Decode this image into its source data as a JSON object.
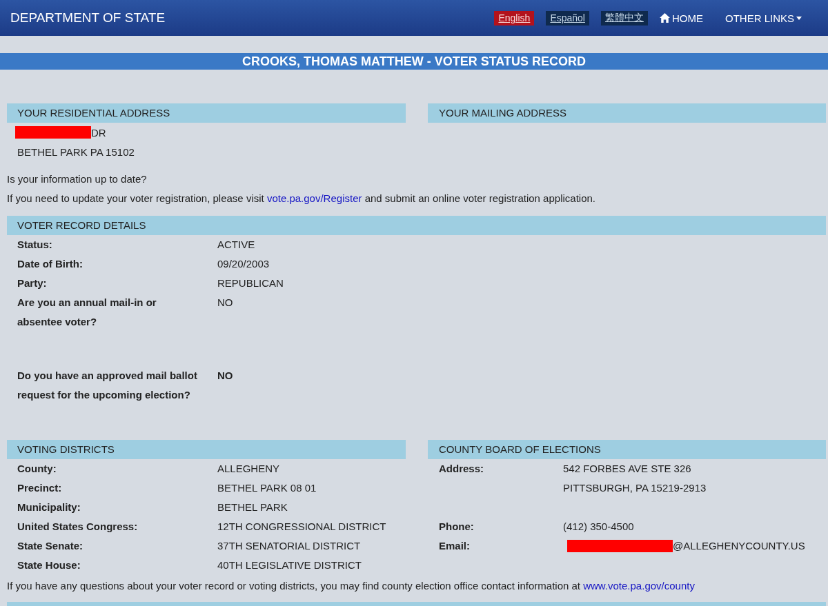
{
  "header": {
    "title": "DEPARTMENT OF STATE",
    "languages": [
      {
        "label": "English",
        "selected": true
      },
      {
        "label": "Español",
        "selected": false
      },
      {
        "label": "繁體中文",
        "selected": false
      }
    ],
    "nav": [
      {
        "label": "HOME",
        "kind": "home"
      },
      {
        "label": "OTHER LINKS",
        "kind": "dropdown"
      }
    ]
  },
  "page_title": "CROOKS, THOMAS MATTHEW - VOTER STATUS RECORD",
  "residential_address": {
    "title": "YOUR RESIDENTIAL ADDRESS",
    "lines": [
      {
        "text": "DR",
        "redacted": true
      },
      {
        "text": "BETHEL PARK PA 15102",
        "redacted": false
      }
    ]
  },
  "mailing_address": {
    "title": "YOUR MAILING ADDRESS"
  },
  "update_notice": {
    "question": "Is your information up to date?",
    "text_before": "If you need to update your voter registration, please visit",
    "link": "vote.pa.gov/Register",
    "text_after": "and submit an online voter registration application."
  },
  "voter_record": {
    "title": "VOTER RECORD DETAILS",
    "rows": [
      {
        "label": "Status:",
        "value": "ACTIVE"
      },
      {
        "label": "Date of Birth:",
        "value": "09/20/2003"
      },
      {
        "label": "Party:",
        "value": "REPUBLICAN"
      },
      {
        "label": "Are you an annual mail-in or absentee voter?",
        "value": "NO"
      }
    ],
    "mail_ballot_request": {
      "label": "Do you have an approved mail ballot request for the upcoming election?",
      "value": "NO"
    }
  },
  "voting_districts": {
    "title": "VOTING DISTRICTS",
    "rows": [
      {
        "label": "County:",
        "value": "ALLEGHENY"
      },
      {
        "label": "Precinct:",
        "value": "BETHEL PARK 08 01"
      },
      {
        "label": "Municipality:",
        "value": "BETHEL PARK"
      },
      {
        "label": "United States Congress:",
        "value": "12TH CONGRESSIONAL DISTRICT"
      },
      {
        "label": "State Senate:",
        "value": "37TH SENATORIAL DISTRICT"
      },
      {
        "label": "State House:",
        "value": "40TH LEGISLATIVE DISTRICT"
      }
    ]
  },
  "county_board": {
    "title": "COUNTY BOARD OF ELECTIONS",
    "rows": [
      {
        "label": "Address:",
        "lines": [
          "542 FORBES AVE STE 326",
          "PITTSBURGH, PA 15219-2913"
        ],
        "redacted": false
      },
      {
        "label": "Phone:",
        "lines": [
          "(412) 350-4500"
        ],
        "redacted": false
      },
      {
        "label": "Email:",
        "lines": [
          "@ALLEGHENYCOUNTY.US"
        ],
        "redacted": true
      }
    ]
  },
  "footer_notice": {
    "text": "If you have any questions about your voter record or voting districts, you may find county election office contact information at",
    "link": "www.vote.pa.gov/county"
  }
}
